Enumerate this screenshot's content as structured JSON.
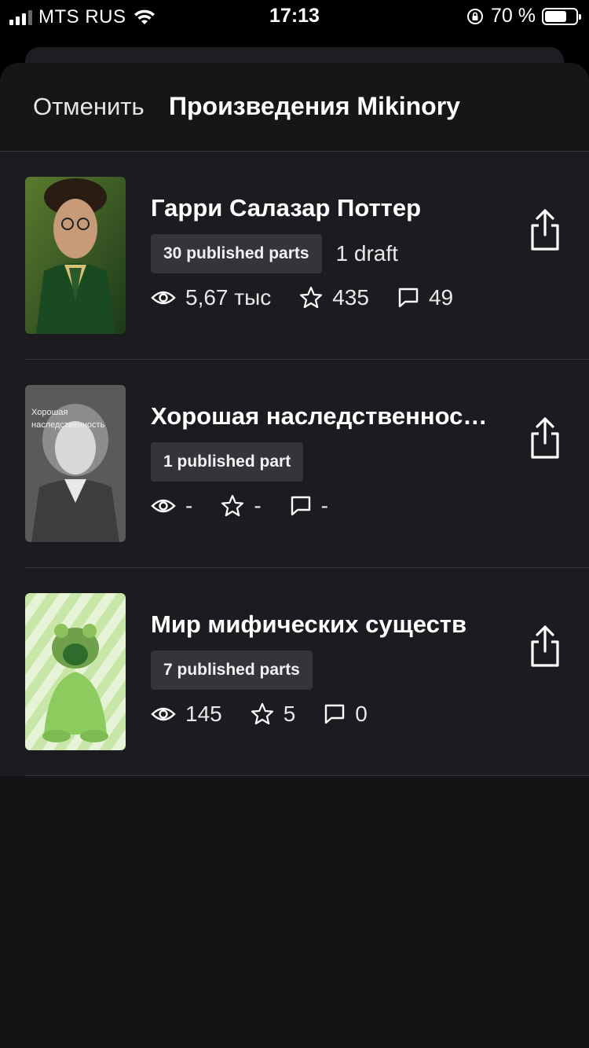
{
  "status_bar": {
    "carrier": "MTS RUS",
    "time": "17:13",
    "battery": "70 %",
    "battery_level": 0.7
  },
  "header": {
    "cancel_label": "Отменить",
    "title": "Произведения Mikinory"
  },
  "works": [
    {
      "title": "Гарри Салазар Поттер",
      "parts_badge": "30 published parts",
      "draft": "1 draft",
      "views": "5,67 тыс",
      "stars": "435",
      "comments": "49",
      "cover_text": ""
    },
    {
      "title": "Хорошая наследственнос…",
      "parts_badge": "1 published part",
      "draft": "",
      "views": "-",
      "stars": "-",
      "comments": "-",
      "cover_text": "Хорошая наследственность"
    },
    {
      "title": "Мир мифических существ",
      "parts_badge": "7 published parts",
      "draft": "",
      "views": "145",
      "stars": "5",
      "comments": "0",
      "cover_text": ""
    }
  ],
  "icons": {
    "views": "eye-icon",
    "stars": "star-icon",
    "comments": "comment-icon",
    "share": "share-icon"
  }
}
